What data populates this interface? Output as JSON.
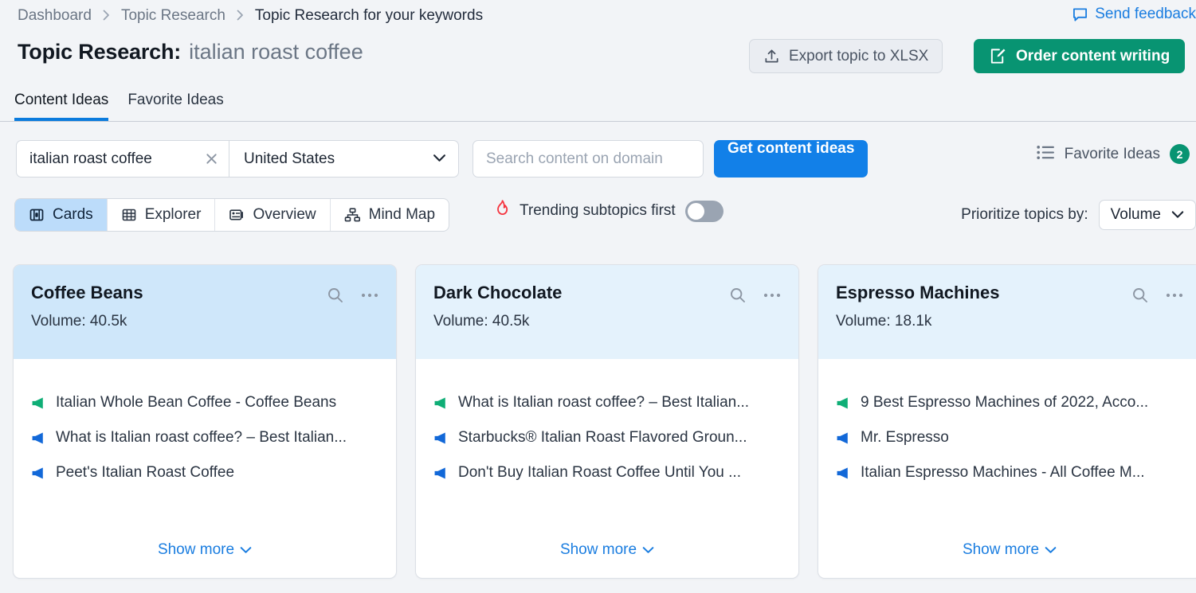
{
  "breadcrumb": {
    "items": [
      {
        "label": "Dashboard",
        "current": false
      },
      {
        "label": "Topic Research",
        "current": false
      },
      {
        "label": "Topic Research for your keywords",
        "current": true
      }
    ]
  },
  "header": {
    "feedback_label": "Send feedback",
    "title_prefix": "Topic Research:",
    "title_keyword": "italian roast coffee",
    "export_label": "Export topic to XLSX",
    "order_label": "Order content writing"
  },
  "tabs": [
    {
      "label": "Content Ideas",
      "active": true
    },
    {
      "label": "Favorite Ideas",
      "active": false
    }
  ],
  "filters": {
    "keyword_value": "italian roast coffee",
    "country_value": "United States",
    "domain_placeholder": "Search content on domain",
    "domain_value": "",
    "get_ideas_label": "Get content ideas",
    "favorite_ideas_label": "Favorite Ideas",
    "favorite_ideas_count": "2"
  },
  "views": {
    "modes": [
      {
        "label": "Cards",
        "icon": "cards-icon",
        "active": true
      },
      {
        "label": "Explorer",
        "icon": "table-icon",
        "active": false
      },
      {
        "label": "Overview",
        "icon": "overview-icon",
        "active": false
      },
      {
        "label": "Mind Map",
        "icon": "mindmap-icon",
        "active": false
      }
    ],
    "trending_label": "Trending subtopics first",
    "trending_on": false,
    "prioritize_label": "Prioritize topics by:",
    "prioritize_value": "Volume"
  },
  "colors": {
    "accent_blue": "#1280e8",
    "accent_green": "#089472",
    "flame_red": "#f5343f",
    "card_head_selected": "#cfe7fa",
    "card_head": "#e4f2fc",
    "idea_green": "#0fae76",
    "idea_blue": "#1268d8"
  },
  "cards": [
    {
      "title": "Coffee Beans",
      "volume": "Volume: 40.5k",
      "selected": true,
      "show_more": "Show more",
      "ideas": [
        {
          "text": "Italian Whole Bean Coffee - Coffee Beans",
          "color": "green"
        },
        {
          "text": "What is Italian roast coffee? – Best Italian...",
          "color": "blue"
        },
        {
          "text": "Peet's Italian Roast Coffee",
          "color": "blue"
        }
      ]
    },
    {
      "title": "Dark Chocolate",
      "volume": "Volume: 40.5k",
      "selected": false,
      "show_more": "Show more",
      "ideas": [
        {
          "text": "What is Italian roast coffee? – Best Italian...",
          "color": "green"
        },
        {
          "text": "Starbucks® Italian Roast Flavored Groun...",
          "color": "blue"
        },
        {
          "text": "Don't Buy Italian Roast Coffee Until You ...",
          "color": "blue"
        }
      ]
    },
    {
      "title": "Espresso Machines",
      "volume": "Volume: 18.1k",
      "selected": false,
      "show_more": "Show more",
      "ideas": [
        {
          "text": "9 Best Espresso Machines of 2022, Acco...",
          "color": "green"
        },
        {
          "text": "Mr. Espresso",
          "color": "blue"
        },
        {
          "text": "Italian Espresso Machines - All Coffee M...",
          "color": "blue"
        }
      ]
    }
  ]
}
